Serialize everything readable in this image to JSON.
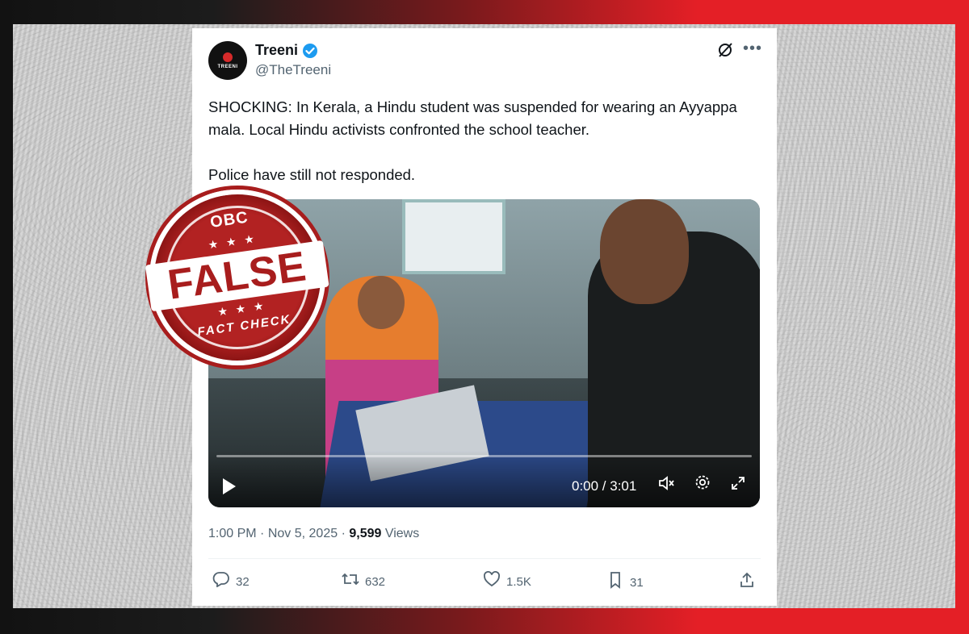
{
  "tweet": {
    "avatar_label": "TREENI",
    "author_name": "Treeni",
    "handle": "@TheTreeni",
    "text_p1": "SHOCKING: In Kerala, a Hindu student was suspended for wearing an Ayyappa mala. Local Hindu activists confronted the school teacher.",
    "text_p2": "Police have still not responded.",
    "video": {
      "time": "0:00 / 3:01"
    },
    "meta": {
      "time": "1:00 PM",
      "sep1": "·",
      "date": "Nov 5, 2025",
      "sep2": "·",
      "views_count": "9,599",
      "views_label": "Views"
    },
    "actions": {
      "replies": "32",
      "reposts": "632",
      "likes": "1.5K",
      "bookmarks": "31"
    }
  },
  "stamp": {
    "brand": "OBC",
    "stars": "★ ★ ★",
    "verdict": "FALSE",
    "label": "FACT CHECK"
  },
  "icons": [
    "verified-badge-icon",
    "grok-icon",
    "more-icon",
    "play-icon",
    "volume-icon",
    "settings-icon",
    "fullscreen-icon",
    "reply-icon",
    "repost-icon",
    "like-icon",
    "bookmark-icon",
    "share-icon"
  ],
  "colors": {
    "accent_red": "#e41f26",
    "verified_blue": "#1d9bf0",
    "text": "#0f1419",
    "muted": "#536471"
  }
}
